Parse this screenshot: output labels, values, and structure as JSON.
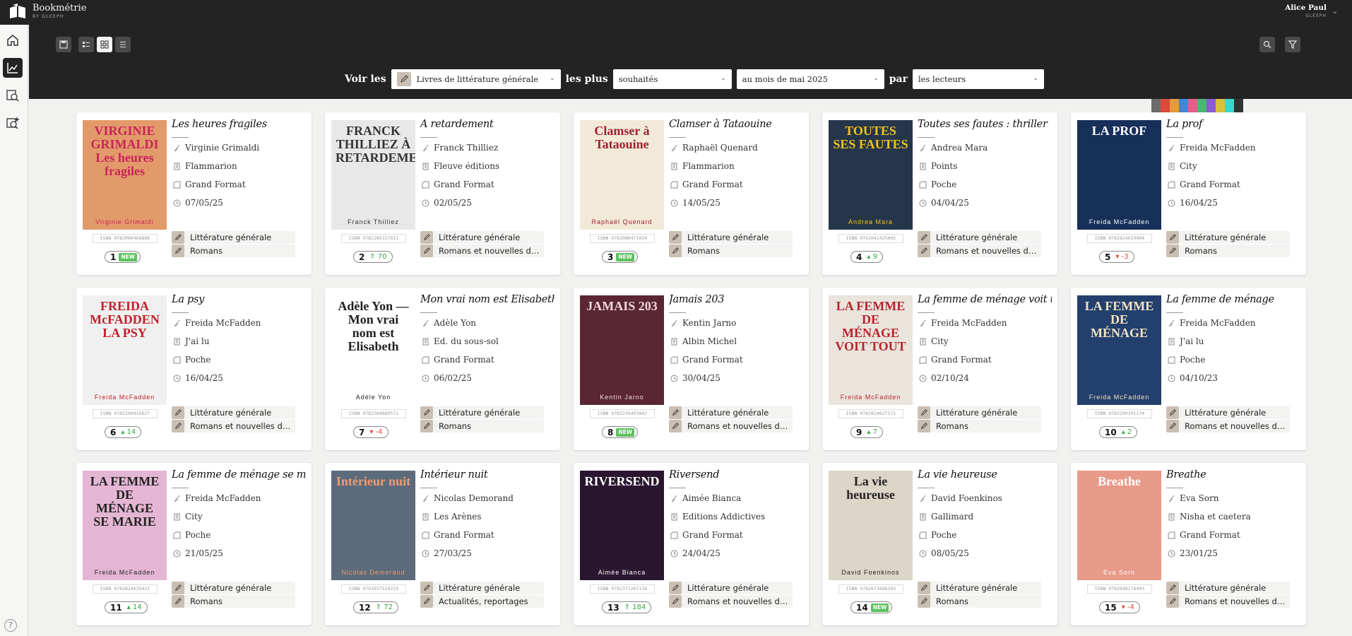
{
  "app": {
    "name": "Bookmétrie",
    "byline": "BY GLEEPH"
  },
  "user": {
    "name": "Alice Paul",
    "org": "GLEEPH"
  },
  "sidebar": {
    "items": [
      "home",
      "rankings",
      "search-book",
      "search-new"
    ],
    "help": "?"
  },
  "query": {
    "prefix": "Voir les",
    "category": "Livres de littérature générale",
    "mid": "les plus",
    "metric": "souhaités",
    "period": "au mois de mai 2025",
    "by": "par",
    "audience": "les lecteurs"
  },
  "colors": {
    "dark": "#232323",
    "new": "#5cc15f",
    "up": "#3aa845",
    "down": "#e04a3a",
    "tagIcon": "#c9bfb2"
  },
  "books": [
    {
      "rank": "1",
      "trend": "NEW",
      "trend_type": "new",
      "title": "Les heures fragiles",
      "author": "Virginie Grimaldi",
      "publisher": "Flammarion",
      "format": "Grand Format",
      "date": "07/05/25",
      "isbn": "ISBN 9782080468888",
      "genre": "Littérature générale",
      "subgenre": "Romans",
      "cover_title": "VIRGINIE GRIMALDI Les heures fragiles",
      "cover_bg": "#e39a6a",
      "cover_fg": "#c8235b"
    },
    {
      "rank": "2",
      "trend": "70",
      "trend_type": "up2",
      "title": "A retardement",
      "author": "Franck Thilliez",
      "publisher": "Fleuve éditions",
      "format": "Grand Format",
      "date": "02/05/25",
      "isbn": "ISBN 9782265157811",
      "genre": "Littérature générale",
      "subgenre": "Romans et nouvelles de g…",
      "cover_title": "FRANCK THILLIEZ À RETARDEMENT",
      "cover_bg": "#e8e8e8",
      "cover_fg": "#333333"
    },
    {
      "rank": "3",
      "trend": "NEW",
      "trend_type": "new",
      "title": "Clamser à Tataouine",
      "author": "Raphaël Quenard",
      "publisher": "Flammarion",
      "format": "Grand Format",
      "date": "14/05/25",
      "isbn": "ISBN 9782080471024",
      "genre": "Littérature générale",
      "subgenre": "Romans",
      "cover_title": "Clamser à Tataouine",
      "cover_bg": "#f2e9d8",
      "cover_fg": "#a02030"
    },
    {
      "rank": "4",
      "trend": "9",
      "trend_type": "up",
      "title": "Toutes ses fautes : thriller",
      "author": "Andrea Mara",
      "publisher": "Points",
      "format": "Poche",
      "date": "04/04/25",
      "isbn": "ISBN 9791041425095",
      "genre": "Littérature générale",
      "subgenre": "Romans et nouvelles de g…",
      "cover_title": "TOUTES SES FAUTES",
      "cover_bg": "#26364a",
      "cover_fg": "#f3c21a"
    },
    {
      "rank": "5",
      "trend": "-3",
      "trend_type": "down",
      "title": "La prof",
      "author": "Freida McFadden",
      "publisher": "City",
      "format": "Grand Format",
      "date": "16/04/25",
      "isbn": "ISBN 9782824629094",
      "genre": "Littérature générale",
      "subgenre": "Romans",
      "cover_title": "LA PROF",
      "cover_bg": "#17305a",
      "cover_fg": "#ffffff"
    },
    {
      "rank": "6",
      "trend": "14",
      "trend_type": "up",
      "title": "La psy",
      "author": "Freida McFadden",
      "publisher": "J'ai lu",
      "format": "Poche",
      "date": "16/04/25",
      "isbn": "ISBN 9782290415627",
      "genre": "Littérature générale",
      "subgenre": "Romans et nouvelles de g…",
      "cover_title": "FREIDA McFADDEN LA PSY",
      "cover_bg": "#f0f0f0",
      "cover_fg": "#c0202a"
    },
    {
      "rank": "7",
      "trend": "-4",
      "trend_type": "down",
      "title": "Mon vrai nom est Elisabeth",
      "author": "Adèle Yon",
      "publisher": "Ed. du sous-sol",
      "format": "Grand Format",
      "date": "06/02/25",
      "isbn": "ISBN 9782364689572",
      "genre": "Littérature générale",
      "subgenre": "Romans",
      "cover_title": "Adèle Yon — Mon vrai nom est Elisabeth",
      "cover_bg": "#ffffff",
      "cover_fg": "#222222"
    },
    {
      "rank": "8",
      "trend": "NEW",
      "trend_type": "new",
      "title": "Jamais 203",
      "author": "Kentin Jarno",
      "publisher": "Albin Michel",
      "format": "Grand Format",
      "date": "30/04/25",
      "isbn": "ISBN 9782226493842",
      "genre": "Littérature générale",
      "subgenre": "Romans et nouvelles de g…",
      "cover_title": "JAMAIS 203",
      "cover_bg": "#5a2634",
      "cover_fg": "#f2d7dc"
    },
    {
      "rank": "9",
      "trend": "7",
      "trend_type": "up",
      "title": "La femme de ménage voit tout",
      "author": "Freida McFadden",
      "publisher": "City",
      "format": "Grand Format",
      "date": "02/10/24",
      "isbn": "ISBN 9782824627571",
      "genre": "Littérature générale",
      "subgenre": "Romans",
      "cover_title": "LA FEMME DE MÉNAGE VOIT TOUT",
      "cover_bg": "#e9e4dc",
      "cover_fg": "#b8242c"
    },
    {
      "rank": "10",
      "trend": "2",
      "trend_type": "up",
      "title": "La femme de ménage",
      "author": "Freida McFadden",
      "publisher": "J'ai lu",
      "format": "Poche",
      "date": "04/10/23",
      "isbn": "ISBN 9782290391174",
      "genre": "Littérature générale",
      "subgenre": "Romans et nouvelles de g…",
      "cover_title": "LA FEMME DE MÉNAGE",
      "cover_bg": "#233f6e",
      "cover_fg": "#f2e3c0"
    },
    {
      "rank": "11",
      "trend": "14",
      "trend_type": "up",
      "title": "La femme de ménage se marie",
      "author": "Freida McFadden",
      "publisher": "City",
      "format": "Poche",
      "date": "21/05/25",
      "isbn": "ISBN 9782824629421",
      "genre": "Littérature générale",
      "subgenre": "Romans",
      "cover_title": "LA FEMME DE MÉNAGE SE MARIE",
      "cover_bg": "#e4b6d4",
      "cover_fg": "#222222"
    },
    {
      "rank": "12",
      "trend": "72",
      "trend_type": "up2",
      "title": "Intérieur nuit",
      "author": "Nicolas Demorand",
      "publisher": "Les Arènes",
      "format": "Grand Format",
      "date": "27/03/25",
      "isbn": "ISBN 9791037514233",
      "genre": "Littérature générale",
      "subgenre": "Actualités, reportages",
      "cover_title": "Intérieur nuit",
      "cover_bg": "#5b6b7c",
      "cover_fg": "#f39a6a"
    },
    {
      "rank": "13",
      "trend": "184",
      "trend_type": "up2",
      "title": "Riversend",
      "author": "Aimée Bianca",
      "publisher": "Editions Addictives",
      "format": "Grand Format",
      "date": "24/04/25",
      "isbn": "ISBN 9782371267138",
      "genre": "Littérature générale",
      "subgenre": "Romans et nouvelles de g…",
      "cover_title": "RIVERSEND",
      "cover_bg": "#2a1630",
      "cover_fg": "#ffffff"
    },
    {
      "rank": "14",
      "trend": "NEW",
      "trend_type": "new",
      "title": "La vie heureuse",
      "author": "David Foenkinos",
      "publisher": "Gallimard",
      "format": "Poche",
      "date": "08/05/25",
      "isbn": "ISBN 9782073086203",
      "genre": "Littérature générale",
      "subgenre": "Romans",
      "cover_title": "La vie heureuse",
      "cover_bg": "#dcd6c8",
      "cover_fg": "#222222"
    },
    {
      "rank": "15",
      "trend": "-4",
      "trend_type": "down",
      "title": "Breathe",
      "author": "Eva Sorn",
      "publisher": "Nisha et caetera",
      "format": "Grand Format",
      "date": "23/01/25",
      "isbn": "ISBN 9782848178403",
      "genre": "Littérature générale",
      "subgenre": "Romans et nouvelles de g…",
      "cover_title": "Breathe",
      "cover_bg": "#e89a88",
      "cover_fg": "#ffffff"
    }
  ]
}
